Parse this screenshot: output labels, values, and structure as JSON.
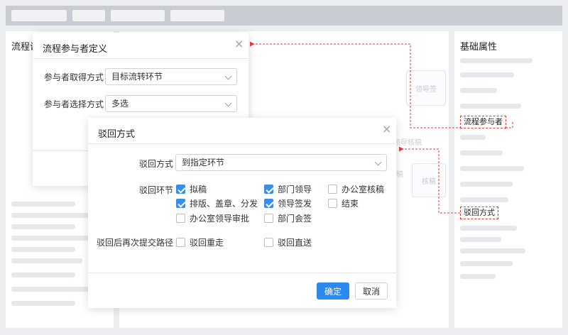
{
  "left_panel": {
    "title": "流程设"
  },
  "right_panel": {
    "title": "基础属性"
  },
  "background_flow": {
    "node_1": "领导签",
    "node_2": "核稿",
    "label_1": "领导核稿",
    "label_2": "稿"
  },
  "participant_dialog": {
    "title": "流程参与者定义",
    "acquire_label": "参与者取得方式",
    "acquire_value": "目标流转环节",
    "select_label": "参与者选择方式",
    "select_value": "多选"
  },
  "reject_dialog": {
    "title": "驳回方式",
    "mode_label": "驳回方式",
    "mode_value": "到指定环节",
    "steps_label": "驳回环节",
    "steps": [
      {
        "label": "拟稿",
        "checked": true
      },
      {
        "label": "部门领导",
        "checked": true
      },
      {
        "label": "办公室核稿",
        "checked": false
      },
      {
        "label": "排版、盖章、分发",
        "checked": true
      },
      {
        "label": "领导签发",
        "checked": true
      },
      {
        "label": "结束",
        "checked": false
      },
      {
        "label": "办公室领导审批",
        "checked": false
      },
      {
        "label": "部门会签",
        "checked": false
      }
    ],
    "resubmit_label": "驳回后再次提交路径",
    "resubmit_options": [
      {
        "label": "驳回重走",
        "checked": false
      },
      {
        "label": "驳回直送",
        "checked": false
      }
    ],
    "ok_label": "确定",
    "cancel_label": "取消"
  },
  "callouts": {
    "participants": "流程参与者",
    "reject": "驳回方式"
  },
  "colors": {
    "primary": "#2b89ef",
    "checkbox": "#3a8ee6",
    "callout": "#e23b3b"
  }
}
